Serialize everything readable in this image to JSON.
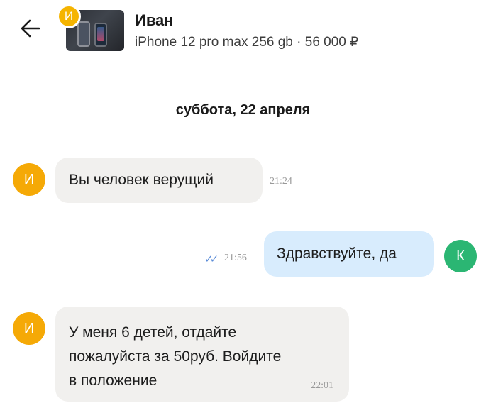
{
  "header": {
    "contact_name": "Иван",
    "listing_title": "iPhone 12 pro max 256 gb · 56 000 ₽",
    "avatar_letter": "И"
  },
  "chat": {
    "date_separator": "суббота, 22 апреля",
    "messages": [
      {
        "direction": "incoming",
        "avatar_letter": "И",
        "text": "Вы человек верущий",
        "time": "21:24"
      },
      {
        "direction": "outgoing",
        "avatar_letter": "К",
        "text": "Здравствуйте, да",
        "time": "21:56",
        "status": "read"
      },
      {
        "direction": "incoming",
        "avatar_letter": "И",
        "text_lines": [
          "У меня 6 детей, отдайте",
          "пожалуйста за 50руб. Войдите",
          "в положение"
        ],
        "time": "22:01"
      }
    ]
  },
  "colors": {
    "incoming_bubble": "#f1f0ee",
    "outgoing_bubble": "#d8ecfd",
    "avatar_incoming": "#f5a906",
    "avatar_outgoing": "#2bb673",
    "read_ticks": "#5b8cd8"
  },
  "icons": {
    "back": "arrow-left-icon",
    "read_status": "double-check-icon"
  }
}
